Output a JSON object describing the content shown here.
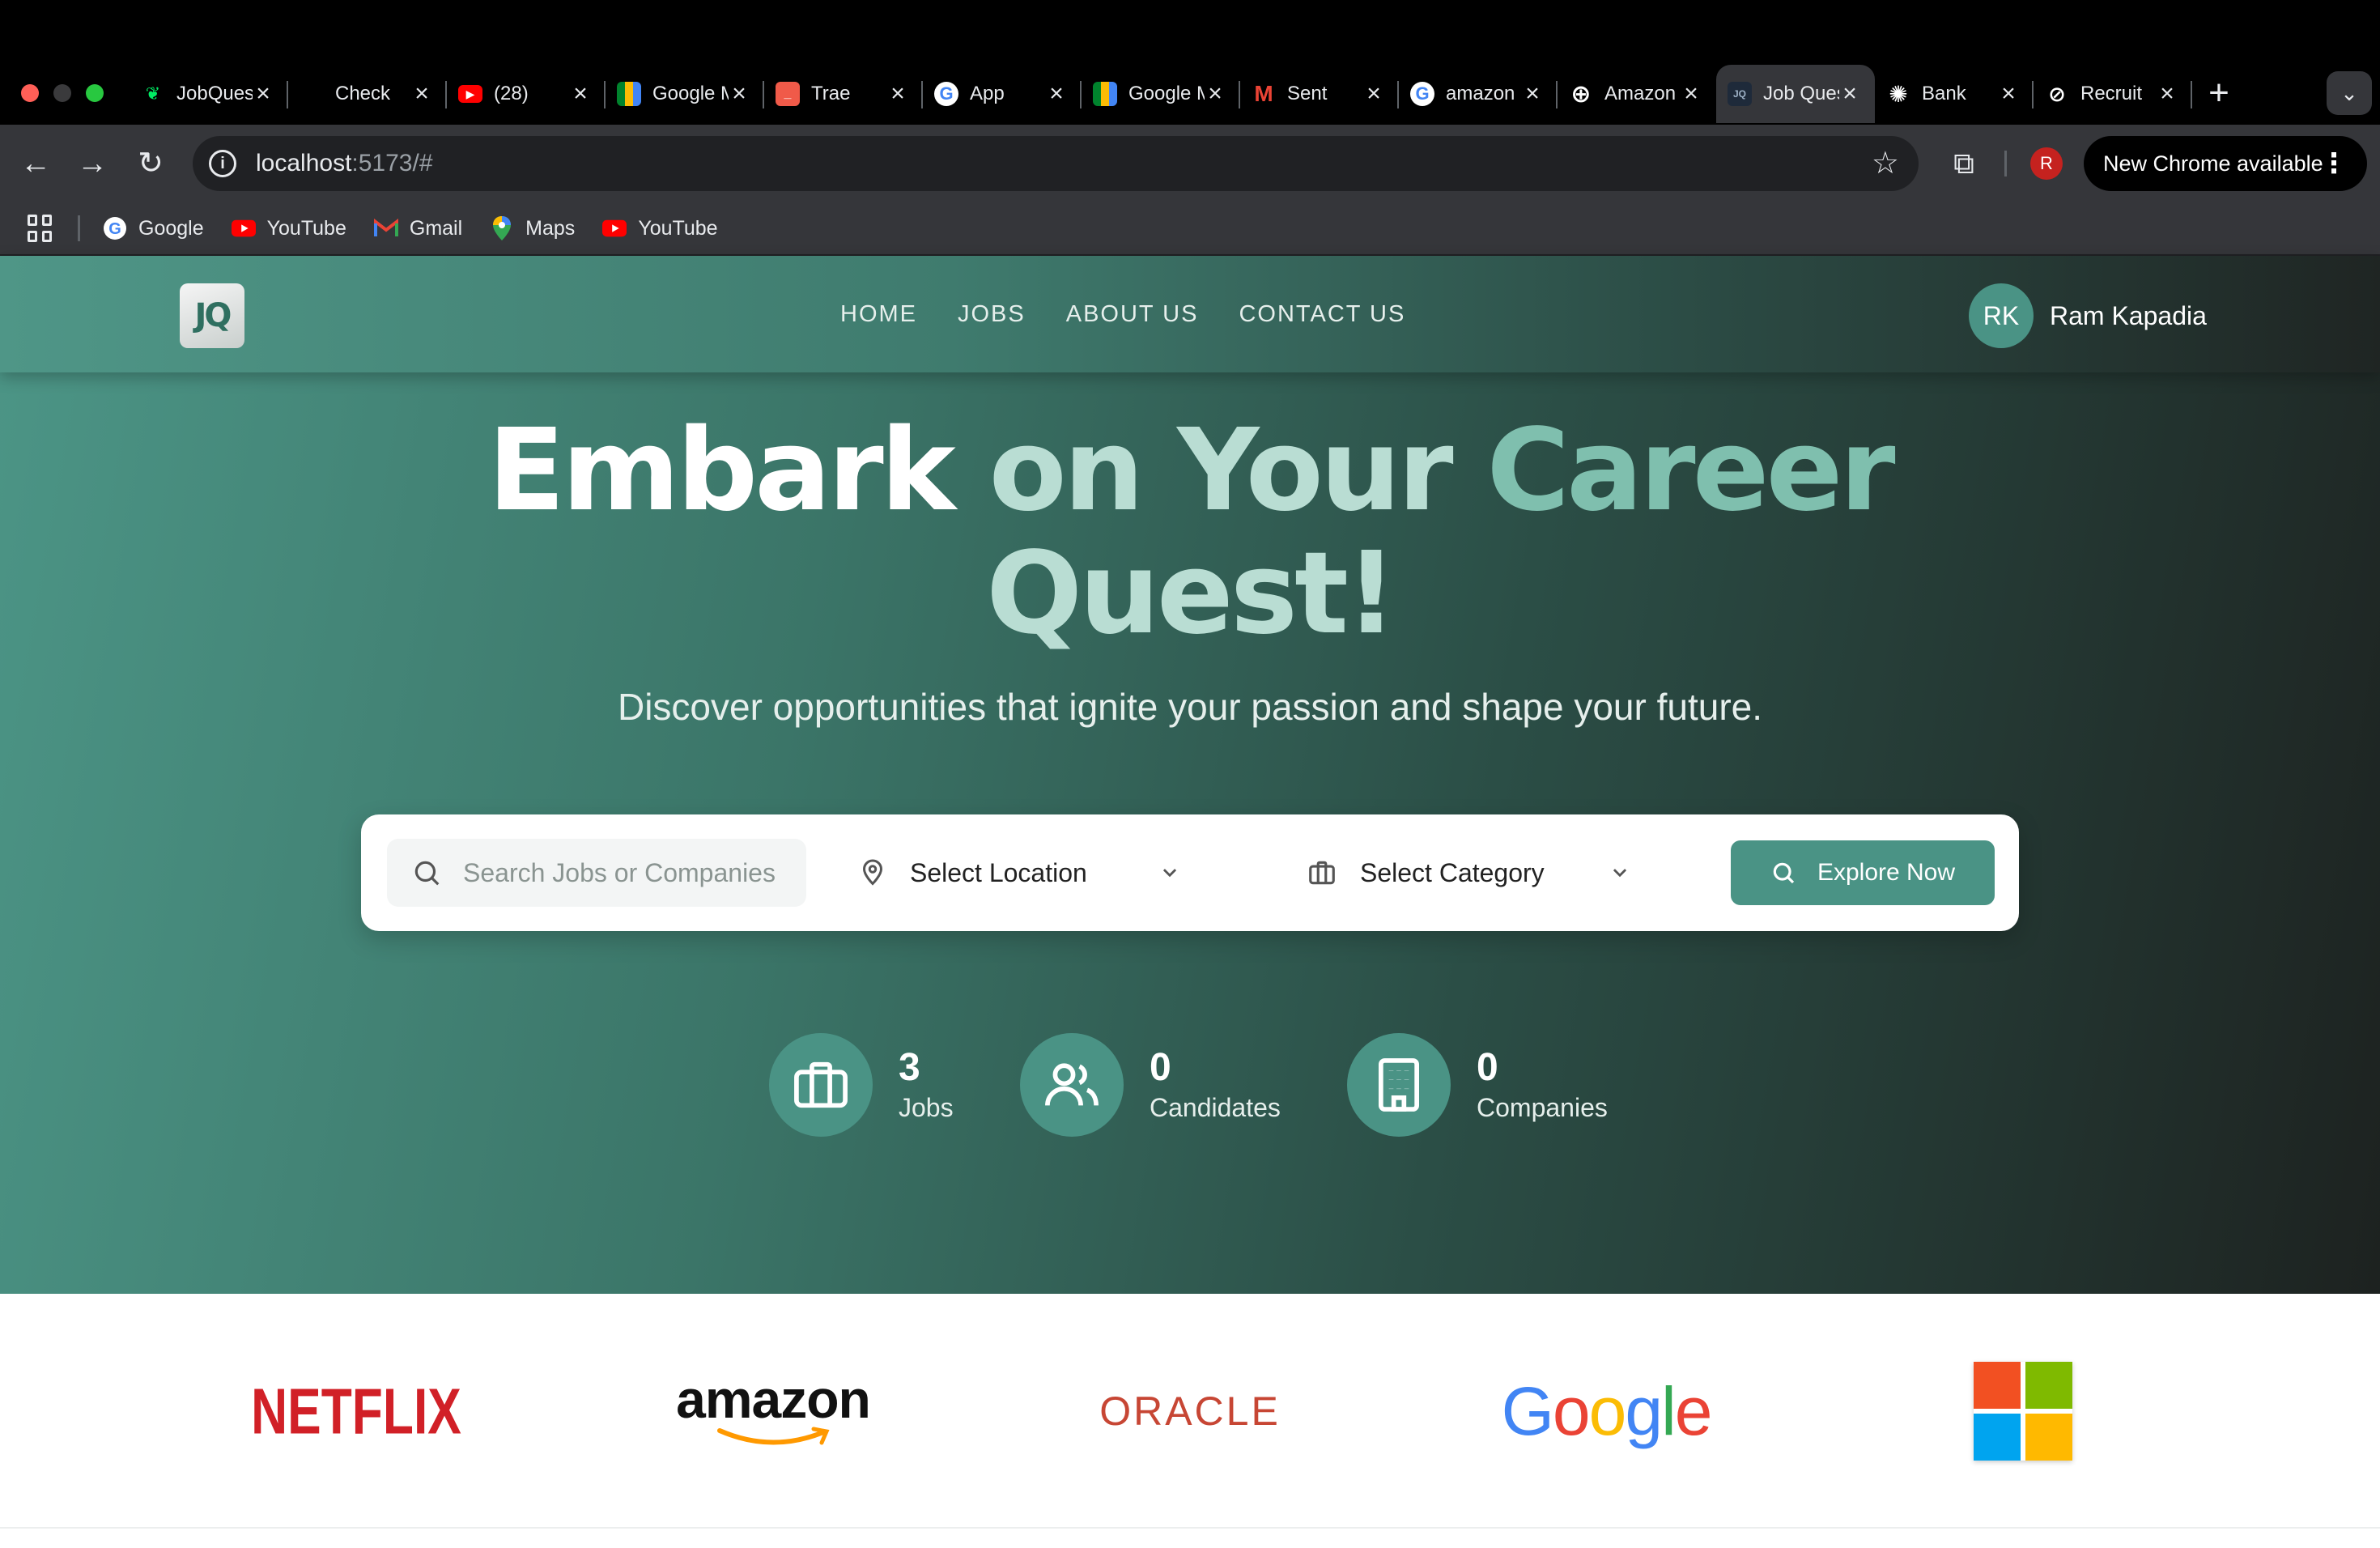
{
  "browser": {
    "tabs": [
      {
        "title": "JobQuest",
        "icon": "mongodb-leaf-icon"
      },
      {
        "title": "Check",
        "icon": "blank-icon"
      },
      {
        "title": "(28)",
        "icon": "youtube-icon"
      },
      {
        "title": "Google Meet",
        "icon": "google-meet-icon"
      },
      {
        "title": "Trae",
        "icon": "trae-icon"
      },
      {
        "title": "App",
        "icon": "google-icon"
      },
      {
        "title": "Google Meet",
        "icon": "google-meet-icon"
      },
      {
        "title": "Sent",
        "icon": "gmail-icon"
      },
      {
        "title": "amazon",
        "icon": "google-icon"
      },
      {
        "title": "Amazon",
        "icon": "perplexity-icon"
      },
      {
        "title": "Job Quest",
        "icon": "jobquest-icon",
        "active": true
      },
      {
        "title": "Bank",
        "icon": "openai-icon"
      },
      {
        "title": "Recruit",
        "icon": "recruit-icon"
      }
    ],
    "url_host": "localhost",
    "url_rest": ":5173/#",
    "profile_initial": "R",
    "new_chrome_label": "New Chrome available",
    "bookmarks": [
      {
        "label": "Google",
        "icon": "google-icon"
      },
      {
        "label": "YouTube",
        "icon": "youtube-icon"
      },
      {
        "label": "Gmail",
        "icon": "gmail-icon"
      },
      {
        "label": "Maps",
        "icon": "maps-pin-icon"
      },
      {
        "label": "YouTube",
        "icon": "youtube-icon"
      }
    ]
  },
  "site": {
    "logo_text": "JQ",
    "nav": [
      "HOME",
      "JOBS",
      "ABOUT US",
      "CONTACT US"
    ],
    "user": {
      "initials": "RK",
      "name": "Ram Kapadia"
    },
    "headline": {
      "part1": "Embark",
      "part2": "on Your",
      "part3": "Career",
      "part4": "Quest!"
    },
    "subtitle": "Discover opportunities that ignite your passion and shape your future.",
    "search": {
      "placeholder": "Search Jobs or Companies",
      "location": "Select Location",
      "category": "Select Category",
      "button": "Explore Now"
    },
    "stats": [
      {
        "value": "3",
        "label": "Jobs",
        "icon": "briefcase-icon"
      },
      {
        "value": "0",
        "label": "Candidates",
        "icon": "users-icon"
      },
      {
        "value": "0",
        "label": "Companies",
        "icon": "building-icon"
      }
    ],
    "brands": {
      "netflix": "NETFLIX",
      "amazon": "amazon",
      "oracle": "ORACLE",
      "google": "Google",
      "microsoft": "microsoft-logo"
    },
    "colors": {
      "accent": "#4a9385",
      "netflix": "#d12027",
      "oracle": "#c74634",
      "ms_red": "#f25022",
      "ms_green": "#7fba00",
      "ms_blue": "#00a4ef",
      "ms_yellow": "#ffb900"
    }
  }
}
